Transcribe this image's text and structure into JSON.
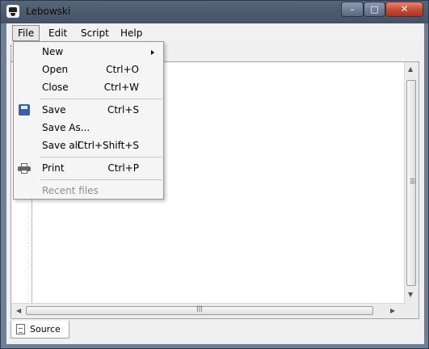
{
  "window": {
    "title": "Lebowski",
    "controls": {
      "minimize": "–",
      "maximize": "□",
      "close": "✕"
    }
  },
  "menubar": {
    "items": [
      "File",
      "Edit",
      "Script",
      "Help"
    ]
  },
  "file_menu": {
    "items": [
      {
        "label": "New",
        "shortcut": "",
        "submenu": true
      },
      {
        "label": "Open",
        "shortcut": "Ctrl+O"
      },
      {
        "label": "Close",
        "shortcut": "Ctrl+W"
      },
      {
        "label": "Save",
        "shortcut": "Ctrl+S",
        "icon": "save-icon"
      },
      {
        "label": "Save As...",
        "shortcut": ""
      },
      {
        "label": "Save all",
        "shortcut": "Ctrl+Shift+S"
      },
      {
        "label": "Print",
        "shortcut": "Ctrl+P",
        "icon": "print-icon"
      },
      {
        "label": "Recent files",
        "shortcut": "",
        "disabled": true
      }
    ]
  },
  "bottom_tabs": [
    {
      "label": "Source",
      "icon": "document-icon"
    }
  ]
}
